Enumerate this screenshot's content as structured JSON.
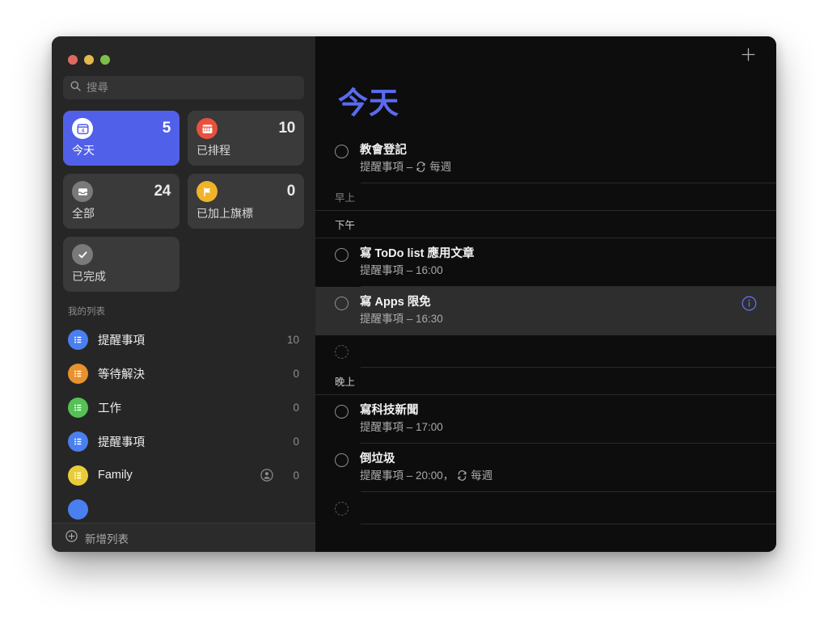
{
  "app": {
    "title": "提醒事項"
  },
  "window_controls": {
    "close": "close-button",
    "minimize": "minimize-button",
    "maximize": "maximize-button"
  },
  "sidebar": {
    "search": {
      "placeholder": "搜尋",
      "value": ""
    },
    "smart_lists": [
      {
        "label": "今天",
        "count": "5",
        "icon": "today-calendar-icon",
        "color": "#ffffff",
        "selected": true
      },
      {
        "label": "已排程",
        "count": "10",
        "icon": "scheduled-calendar-icon",
        "color": "#e8513c",
        "selected": false
      },
      {
        "label": "全部",
        "count": "24",
        "icon": "inbox-tray-icon",
        "color": "#7a7a7a",
        "selected": false
      },
      {
        "label": "已加上旗標",
        "count": "0",
        "icon": "flag-icon",
        "color": "#f0b429",
        "selected": false
      },
      {
        "label": "已完成",
        "count": "",
        "icon": "checkmark-icon",
        "color": "#7a7a7a",
        "selected": false
      }
    ],
    "my_lists_header": "我的列表",
    "lists": [
      {
        "name": "提醒事項",
        "count": "10",
        "color": "#4a7ff0",
        "icon": "list-bullet-icon",
        "shared": false
      },
      {
        "name": "等待解決",
        "count": "0",
        "color": "#e8912d",
        "icon": "list-bullet-icon",
        "shared": false
      },
      {
        "name": "工作",
        "count": "0",
        "color": "#54c254",
        "icon": "list-bullet-icon",
        "shared": false
      },
      {
        "name": "提醒事項",
        "count": "0",
        "color": "#4a7ff0",
        "icon": "list-bullet-icon",
        "shared": false
      },
      {
        "name": "Family",
        "count": "0",
        "color": "#e8cc3a",
        "icon": "list-bullet-icon",
        "shared": true
      }
    ],
    "add_list": {
      "label": "新增列表",
      "icon": "plus-circle-icon"
    }
  },
  "main": {
    "add_reminder_icon": "plus-icon",
    "title": "今天",
    "title_color": "#5a6bf0",
    "items": [
      {
        "kind": "reminder",
        "title": "教會登記",
        "sub_prefix": "提醒事項 – ",
        "repeat_icon": "repeat-icon",
        "sub_suffix": "每週",
        "hovered": false,
        "info": false
      },
      {
        "kind": "time-header",
        "label": "早上",
        "state": "dim"
      },
      {
        "kind": "time-header",
        "label": "下午",
        "state": "bright"
      },
      {
        "kind": "reminder",
        "title": "寫 ToDo list 應用文章",
        "sub_prefix": "提醒事項 – 16:00",
        "repeat_icon": "",
        "sub_suffix": "",
        "hovered": false,
        "info": false
      },
      {
        "kind": "reminder",
        "title": "寫 Apps 限免",
        "sub_prefix": "提醒事項 – 16:30",
        "repeat_icon": "",
        "sub_suffix": "",
        "hovered": true,
        "info": true,
        "info_icon": "info-circle-icon"
      },
      {
        "kind": "new-row"
      },
      {
        "kind": "time-header",
        "label": "晚上",
        "state": "bright"
      },
      {
        "kind": "reminder",
        "title": "寫科技新聞",
        "sub_prefix": "提醒事項 – 17:00",
        "repeat_icon": "",
        "sub_suffix": "",
        "hovered": false,
        "info": false
      },
      {
        "kind": "reminder",
        "title": "倒垃圾",
        "sub_prefix": "提醒事項 – 20:00，",
        "repeat_icon": "repeat-icon",
        "sub_suffix": "每週",
        "hovered": false,
        "info": false
      },
      {
        "kind": "new-row"
      }
    ]
  },
  "colors": {
    "accent_blue": "#5160e8",
    "sidebar_bg": "#262626",
    "main_bg": "#0d0d0d",
    "card_bg": "#3a3a3a",
    "hover_row": "#2e2e2e"
  }
}
